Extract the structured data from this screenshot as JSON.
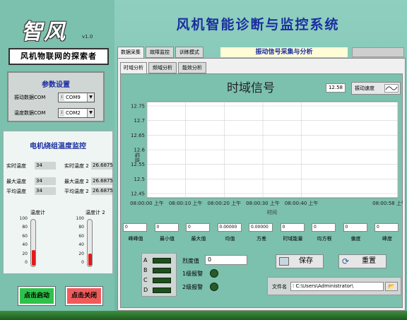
{
  "app": {
    "logo": "智风",
    "version": "v1.0",
    "slogan": "风机物联网的探索者",
    "title": "风机智能诊断与监控系统"
  },
  "params": {
    "title": "参数设置",
    "vib_label": "振动数据COM",
    "vib_value": "COM9",
    "temp_label": "温度数据COM",
    "temp_value": "COM2"
  },
  "monitor": {
    "title": "电机绕组温度监控",
    "rt_label": "实时温度",
    "rt_value": "34",
    "rt2_label": "实时温度 2",
    "rt2_value": "26.6875",
    "max_label": "最大温度",
    "max_value": "34",
    "max2_label": "最大温度 2",
    "max2_value": "26.6875",
    "avg_label": "平均温度",
    "avg_value": "34",
    "avg2_label": "平均温度 2",
    "avg2_value": "26.6875",
    "therm1_label": "温度计",
    "therm2_label": "温度计 2",
    "therm_ticks": [
      "100",
      "80",
      "60",
      "40",
      "20",
      "0"
    ],
    "therm1_level": 0.34,
    "therm2_level": 0.27
  },
  "buttons": {
    "start": "点击启动",
    "stop": "点击关闭",
    "save": "保存",
    "reset": "重置"
  },
  "tabs": {
    "top": [
      "数据采集",
      "故障监控",
      "训练模式"
    ],
    "top_title": "振动信号采集与分析",
    "sub": [
      "时域分析",
      "频域分析",
      "能效分析"
    ]
  },
  "chart_header": {
    "title": "时域信号",
    "rt_value": "12.58",
    "vib_button": "振动速度"
  },
  "chart_data": {
    "type": "line",
    "title": "",
    "xlabel": "时间",
    "ylabel": "幅值",
    "y_ticks": [
      "12.75",
      "12.7",
      "12.65",
      "12.6",
      "12.55",
      "12.5",
      "12.45"
    ],
    "x_ticks": [
      "08:00:00 上午",
      "08:00:10 上午",
      "08:00:20 上午",
      "08:00:30 上午",
      "08:00:40 上午",
      "08:00:58 上午"
    ],
    "ylim": [
      12.45,
      12.75
    ],
    "series": []
  },
  "stats": {
    "values": [
      "0",
      "0",
      "0",
      "0.00000",
      "0.00000",
      "0",
      "0",
      "0",
      "0"
    ],
    "labels": [
      "峰峰值",
      "最小值",
      "最大值",
      "均值",
      "方差",
      "时域能量",
      "均方根",
      "偏度",
      "峰度"
    ]
  },
  "alarm": {
    "leds": [
      "A",
      "B",
      "C",
      "D"
    ],
    "severity_label": "烈度值",
    "severity_value": "0",
    "alarm1": "1级报警",
    "alarm2": "2级报警"
  },
  "file": {
    "label": "文件名",
    "path": "C:\\Users\\Administrator\\"
  },
  "colors": {
    "accent": "#1a2ea0",
    "background": "#7cc0ae",
    "start": "#2ec24a",
    "stop": "#f05a5a"
  }
}
